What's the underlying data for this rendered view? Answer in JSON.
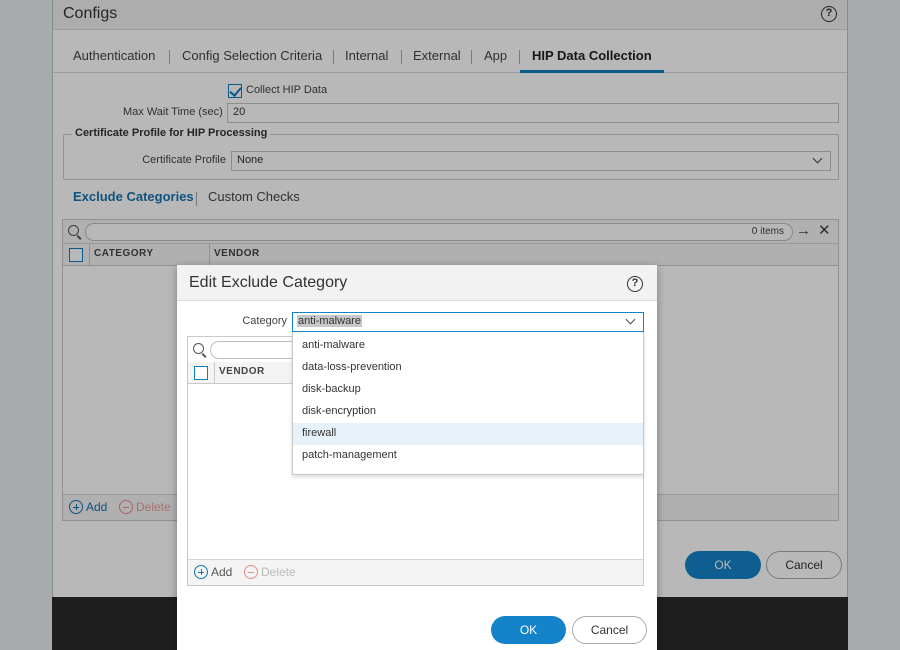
{
  "background": {
    "window_title": "Configs",
    "tabs": [
      "Authentication",
      "Config Selection Criteria",
      "Internal",
      "External",
      "App",
      "HIP Data Collection"
    ],
    "active_tab": "HIP Data Collection",
    "collect_hip_label": "Collect HIP Data",
    "max_wait_label": "Max Wait Time (sec)",
    "max_wait_value": "20",
    "cert_profile_section": "Certificate Profile for HIP Processing",
    "cert_profile_label": "Certificate Profile",
    "cert_profile_value": "None",
    "subtabs": [
      "Exclude Categories",
      "Custom Checks"
    ],
    "items_count": "0 items",
    "columns": [
      "CATEGORY",
      "VENDOR"
    ],
    "add_label": "Add",
    "delete_label": "Delete",
    "ok_label": "OK",
    "cancel_label": "Cancel"
  },
  "modal": {
    "title": "Edit Exclude Category",
    "category_label": "Category",
    "category_value": "anti-malware",
    "dropdown_options": [
      "anti-malware",
      "data-loss-prevention",
      "disk-backup",
      "disk-encryption",
      "firewall",
      "patch-management"
    ],
    "hovered_option": "firewall",
    "vendor_column": "VENDOR",
    "add_label": "Add",
    "delete_label": "Delete",
    "ok_label": "OK",
    "cancel_label": "Cancel"
  },
  "colors": {
    "accent": "#1583c9",
    "active_tab_underline": "#0c7fc0"
  }
}
